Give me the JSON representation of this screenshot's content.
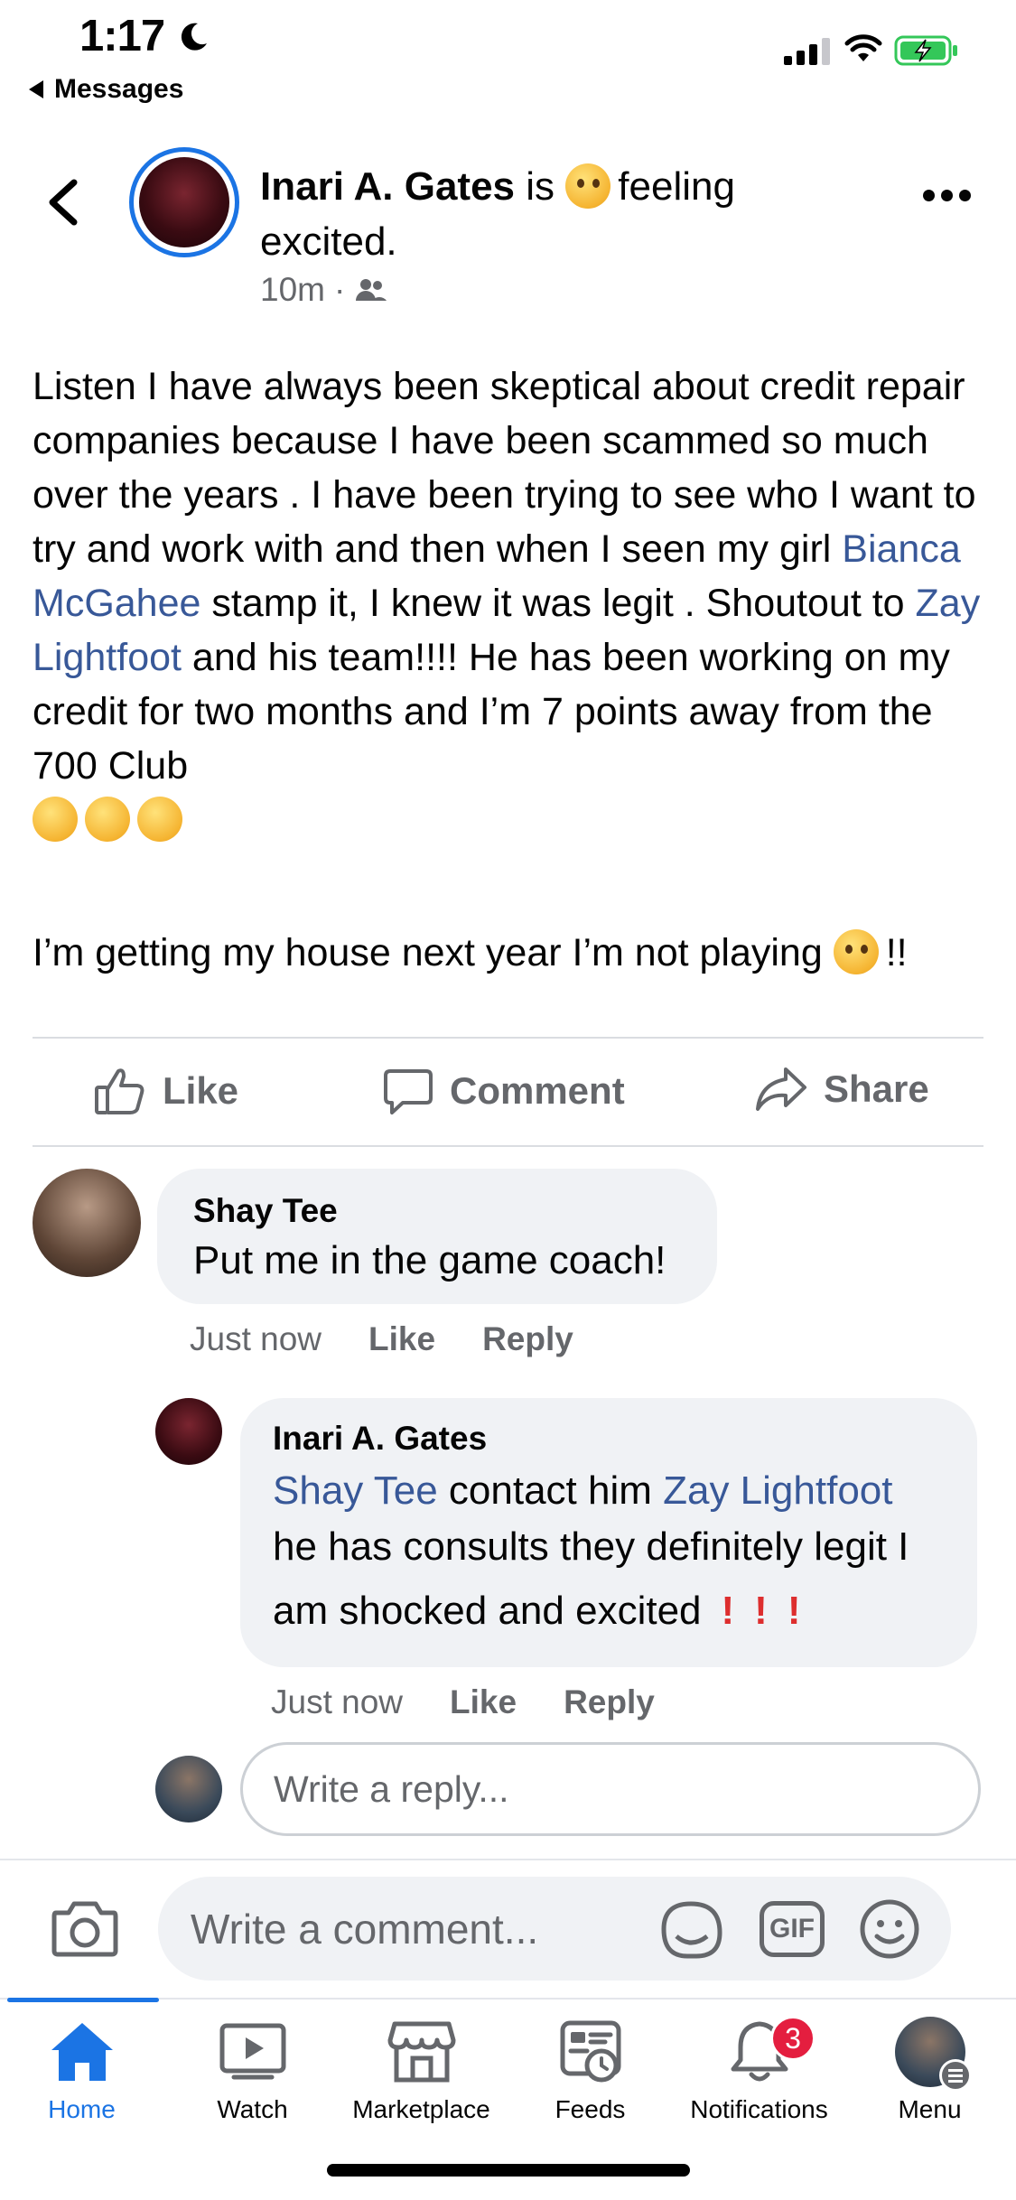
{
  "status_bar": {
    "time": "1:17",
    "back_app": "Messages"
  },
  "post": {
    "author": "Inari A. Gates",
    "activity_prefix": "is",
    "activity": "feeling",
    "activity_line2": "excited.",
    "time": "10m",
    "audience_separator": "·",
    "text_parts": {
      "p1": "Listen I have always been skeptical about credit repair companies because I have been scammed so much over the years . I have been trying to see who I want to try and work with and then when I seen my girl ",
      "mention1": "Bianca McGahee",
      "p2": " stamp it, I knew it was legit . Shoutout to ",
      "mention2": "Zay Lightfoot",
      "p3": " and his team!!!! He has been working on my credit for two months and I’m 7 points away from the 700 Club"
    },
    "text2": "I’m getting my house next year I’m not playing",
    "text2_suffix": "!!"
  },
  "actions": {
    "like": "Like",
    "comment": "Comment",
    "share": "Share"
  },
  "comments": [
    {
      "author": "Shay Tee",
      "text": "Put me in the game coach!",
      "time": "Just now",
      "like": "Like",
      "reply": "Reply"
    },
    {
      "author": "Inari A. Gates",
      "mention1": "Shay Tee",
      "mid": " contact him ",
      "mention2": "Zay Lightfoot",
      "line2": "he has consults they definitely legit I",
      "line3": "am shocked and excited",
      "excl": "!",
      "time": "Just now",
      "like": "Like",
      "reply": "Reply"
    }
  ],
  "reply_placeholder": "Write a reply...",
  "comment_placeholder": "Write a comment...",
  "gif_label": "GIF",
  "tabs": [
    {
      "label": "Home",
      "icon": "home-icon",
      "active": true
    },
    {
      "label": "Watch",
      "icon": "watch-icon"
    },
    {
      "label": "Marketplace",
      "icon": "marketplace-icon"
    },
    {
      "label": "Feeds",
      "icon": "feeds-icon"
    },
    {
      "label": "Notifications",
      "icon": "bell-icon",
      "badge": "3"
    },
    {
      "label": "Menu",
      "icon": "avatar"
    }
  ],
  "colors": {
    "accent": "#1b74e4",
    "link": "#385898",
    "badge": "#e41e3f",
    "exclaim": "#dd2e2e"
  }
}
